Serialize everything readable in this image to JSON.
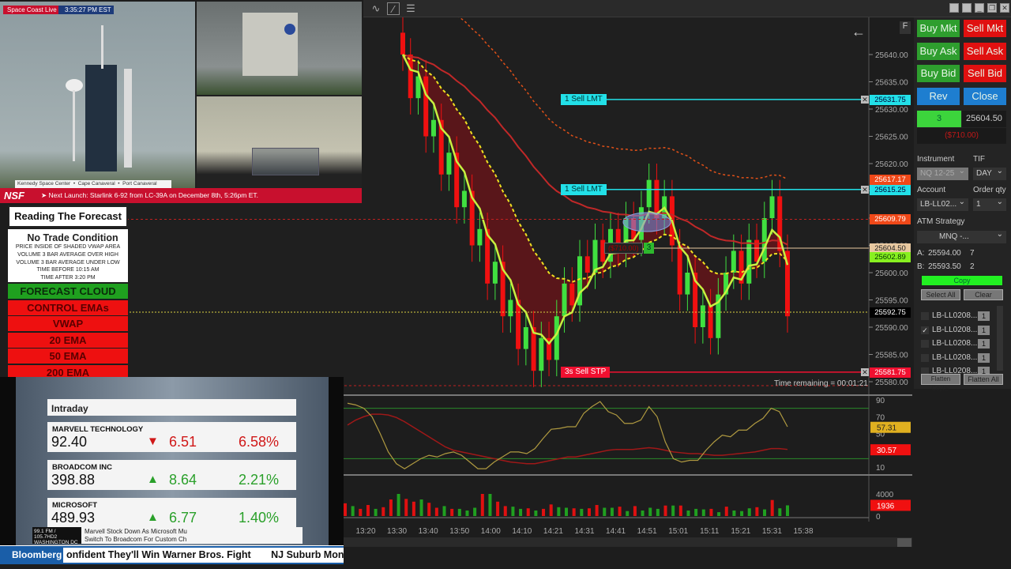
{
  "toolbar": {
    "icons": [
      "indicator-icon",
      "strategy-icon",
      "list-icon"
    ]
  },
  "window_buttons": [
    "minimize",
    "restore",
    "close"
  ],
  "video": {
    "brand": "Space Coast Live",
    "clock": "3:35:27 PM EST",
    "locations": "Kennedy Space Center  •  Cape Canaveral  •  Port Canaveral",
    "logo": "NSF",
    "ticker": "➤ Next Launch: Starlink 6-92 from LC-39A on December 8th, 5:26pm ET."
  },
  "forecast": {
    "title": "Reading The Forecast",
    "heading": "No Trade Condition",
    "conditions": [
      "PRICE INSIDE OF SHADED VWAP AREA",
      "VOLUME 3 BAR AVERAGE OVER HIGH",
      "VOLUME 3 BAR AVERAGE UNDER LOW",
      "TIME BEFORE 10:15 AM",
      "TIME AFTER 3:20 PM"
    ],
    "rows": [
      {
        "label": "FORECAST CLOUD",
        "color": "#1fa01f"
      },
      {
        "label": "CONTROL EMAs",
        "color": "#ee1010"
      },
      {
        "label": "VWAP",
        "color": "#ee1010"
      },
      {
        "label": "20 EMA",
        "color": "#ee1010"
      },
      {
        "label": "50 EMA",
        "color": "#ee1010"
      },
      {
        "label": "200 EMA",
        "color": "#ee1010"
      }
    ]
  },
  "bloomberg": {
    "header": "Intraday",
    "stocks": [
      {
        "name": "MARVELL TECHNOLOGY",
        "price": "92.40",
        "dir": "down",
        "change": "6.51",
        "pct": "6.58%"
      },
      {
        "name": "BROADCOM INC",
        "price": "398.88",
        "dir": "up",
        "change": "8.64",
        "pct": "2.21%"
      },
      {
        "name": "MICROSOFT",
        "price": "489.93",
        "dir": "up",
        "change": "6.77",
        "pct": "1.40%"
      }
    ],
    "station": "99.1 FM / 105.7HD2",
    "city": "WASHINGTON DC",
    "headline1": "Marvell Stock Down As Microsoft Mu",
    "headline2": "Switch To Broadcom For Custom Ch",
    "logo": "Bloomberg",
    "crawl1": "onfident  They'll Win Warner Bros.  Fight",
    "crawl2": "NJ Suburb Montclai"
  },
  "chart": {
    "f_label": "F",
    "back_icon": "arrow-left-icon",
    "price_ticks": [
      "25640.00",
      "25635.00",
      "25630.00",
      "25625.00",
      "25620.00",
      "25615.00",
      "25610.00",
      "25605.00",
      "25600.00",
      "25595.00",
      "25590.00",
      "25585.00",
      "25580.00"
    ],
    "tags": [
      {
        "value": "25631.75",
        "price": 25631.75,
        "bg": "#22e0e8",
        "fg": "#003"
      },
      {
        "value": "25617.17",
        "price": 25617.17,
        "bg": "#f04818",
        "fg": "#fff"
      },
      {
        "value": "25615.25",
        "price": 25615.25,
        "bg": "#22e0e8",
        "fg": "#003"
      },
      {
        "value": "25609.79",
        "price": 25609.79,
        "bg": "#f04818",
        "fg": "#fff"
      },
      {
        "value": "25604.50",
        "price": 25604.5,
        "bg": "#e8c8a0",
        "fg": "#222"
      },
      {
        "value": "25602.89",
        "price": 25602.89,
        "bg": "#88f020",
        "fg": "#030"
      },
      {
        "value": "25592.75",
        "price": 25592.75,
        "bg": "#000",
        "fg": "#fff"
      },
      {
        "value": "25581.75",
        "price": 25581.75,
        "bg": "#f01030",
        "fg": "#fff"
      }
    ],
    "orders": [
      {
        "label": "1 Sell LMT",
        "price": 25631.75,
        "color": "#22e0e8"
      },
      {
        "label": "1 Sell LMT",
        "price": 25615.25,
        "color": "#22e0e8"
      },
      {
        "label": "3s Sell STP",
        "price": 25581.75,
        "color": "#f01030"
      }
    ],
    "position": {
      "pnl": "($710.00)",
      "qty": "3",
      "price": 25604.5
    },
    "time_remaining": "Time remaining = 00:01:21",
    "time_ticks": [
      "13:20",
      "13:30",
      "13:40",
      "13:50",
      "14:00",
      "14:10",
      "14:21",
      "14:31",
      "14:41",
      "14:51",
      "15:01",
      "15:11",
      "15:21",
      "15:31",
      "15:38"
    ],
    "closes": [
      25640,
      25632,
      25636,
      25625,
      25628,
      25618,
      25622,
      25612,
      25615,
      25605,
      25608,
      25598,
      25602,
      25592,
      25595,
      25586,
      25590,
      25582,
      25588,
      25584,
      25592,
      25598,
      25594,
      25603,
      25600,
      25606,
      25602,
      25608,
      25604,
      25610,
      25606,
      25612,
      25617,
      25610,
      25614,
      25605,
      25596,
      25600,
      25590,
      25594,
      25588,
      25596,
      25600,
      25604,
      25598,
      25606,
      25602,
      25610,
      25614,
      25604,
      25592
    ],
    "osc_ticks": [
      "90",
      "70",
      "50",
      "10"
    ],
    "osc_k": [
      86,
      84,
      80,
      70,
      50,
      28,
      14,
      8,
      14,
      20,
      24,
      22,
      26,
      28,
      24,
      16,
      8,
      8,
      16,
      22,
      28,
      28,
      26,
      32,
      44,
      55,
      56,
      58,
      58,
      74,
      82,
      88,
      76,
      72,
      62,
      62,
      66,
      82,
      70,
      40,
      20,
      16,
      18,
      18,
      30,
      40,
      48,
      46,
      54,
      54,
      62,
      68,
      80,
      76,
      58
    ],
    "osc_d": [
      60,
      66,
      70,
      73,
      73,
      72,
      69,
      64,
      58,
      52,
      46,
      40,
      34,
      30,
      28,
      26,
      24,
      22,
      20,
      18,
      16,
      15,
      14,
      14,
      16,
      18,
      20,
      22,
      22,
      24,
      26,
      28,
      30,
      31,
      31,
      31,
      32,
      33,
      32,
      30,
      28,
      27,
      26,
      26,
      25,
      24,
      24,
      25,
      26,
      27,
      28,
      30,
      32,
      32,
      31
    ],
    "osc_k_value": "57.31",
    "osc_d_value": "30.57",
    "vol_ticks": [
      "4000",
      "0"
    ],
    "volumes": [
      2300,
      1800,
      1300,
      2000,
      1300,
      1600,
      3000,
      4000,
      3100,
      2600,
      3000,
      2400,
      1500,
      1800,
      1300,
      1300,
      1000,
      1500,
      4000,
      4000,
      2600,
      1800,
      1700,
      1300,
      1400,
      1000,
      1300,
      2100,
      1600,
      1500,
      1400,
      1300,
      1400,
      2000,
      1500,
      1500,
      1700,
      900,
      1800,
      1000,
      1500,
      1300,
      1900,
      1900,
      1900,
      1000,
      1300,
      1200,
      1300,
      700,
      1700,
      1000,
      900,
      1400,
      1600,
      1200,
      2900,
      1400,
      1936
    ],
    "vol_value": "1936"
  },
  "order_panel": {
    "buttons": [
      [
        "Buy Mkt",
        "Sell Mkt"
      ],
      [
        "Buy Ask",
        "Sell Ask"
      ],
      [
        "Buy Bid",
        "Sell Bid"
      ],
      [
        "Rev",
        "Close"
      ]
    ],
    "position_qty": "3",
    "avg_price": "25604.50",
    "pnl": "($710.00)",
    "instrument_label": "Instrument",
    "instrument": "NQ 12-25",
    "tif_label": "TIF",
    "tif": "DAY",
    "account_label": "Account",
    "account": "LB-LL02...",
    "qty_label": "Order qty",
    "qty": "1",
    "atm_label": "ATM Strategy",
    "atm": "MNQ -...",
    "ask_label": "A:",
    "ask": "25594.00",
    "ask_size": "7",
    "bid_label": "B:",
    "bid": "25593.50",
    "bid_size": "2",
    "copy": "Copy",
    "select_all": "Select All",
    "clear": "Clear",
    "accounts": [
      {
        "name": "LB-LL0208...",
        "qty": "1",
        "checked": false
      },
      {
        "name": "LB-LL0208...",
        "qty": "1",
        "checked": true
      },
      {
        "name": "LB-LL0208...",
        "qty": "1",
        "checked": false
      },
      {
        "name": "LB-LL0208...",
        "qty": "1",
        "checked": false
      },
      {
        "name": "LB-LL0208...",
        "qty": "1",
        "checked": false
      }
    ],
    "flatten_copier": "Flatten Copier",
    "flatten_all": "Flatten All"
  }
}
